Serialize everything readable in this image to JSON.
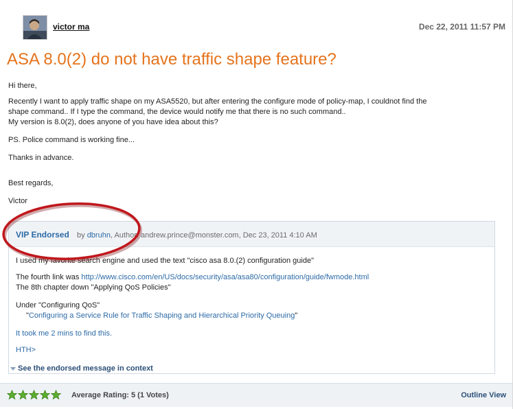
{
  "post": {
    "author": "victor ma",
    "date": "Dec 22, 2011 11:57 PM",
    "title": "ASA 8.0(2) do not have traffic shape feature?",
    "body": {
      "greeting": "Hi there,",
      "p1_line1": "Recently I want to apply traffic shape on my ASA5520, but after entering the configure mode of policy-map, I couldnot find the",
      "p1_line2": "shape command.. If I type the command, the device would notify me that there is no such command..",
      "p1_line3": "My version is 8.0(2), does anyone of you have idea about this?",
      "ps": "PS. Police command is working fine...",
      "thanks": "Thanks in advance.",
      "regards": "Best regards,",
      "signature": "Victor"
    }
  },
  "endorsed": {
    "label": "VIP Endorsed",
    "by_prefix": "by",
    "by_user": "dbruhn",
    "meta_rest": ", Author: andrew.prince@monster.com, Dec 23, 2011 4:10 AM",
    "line1": "I used my favorite search engine and used the text \"cisco asa 8.0.(2) configuration guide\"",
    "line2_prefix": "The fourth link was",
    "line2_link": "http://www.cisco.com/en/US/docs/security/asa/asa80/configuration/guide/fwmode.html",
    "line3": "The 8th chapter down \"Applying QoS Policies\"",
    "line4": "Under \"Configuring QoS\"",
    "line5_quote_open": "\"",
    "line5_link": "Configuring a Service Rule for Traffic Shaping and Hierarchical Priority Queuing",
    "line5_quote_close": "\"",
    "line6": "It took me 2 mins to find this.",
    "line7": "HTH>",
    "context_link": "See the endorsed message in context"
  },
  "footer": {
    "rating_text": "Average Rating: 5 (1 Votes)",
    "rating_value": 5,
    "rating_max": 5,
    "outline_view": "Outline View"
  },
  "colors": {
    "title": "#e5731c",
    "link": "#2c6aa6",
    "annotation": "#c0171c",
    "star": "#5cae2f"
  }
}
